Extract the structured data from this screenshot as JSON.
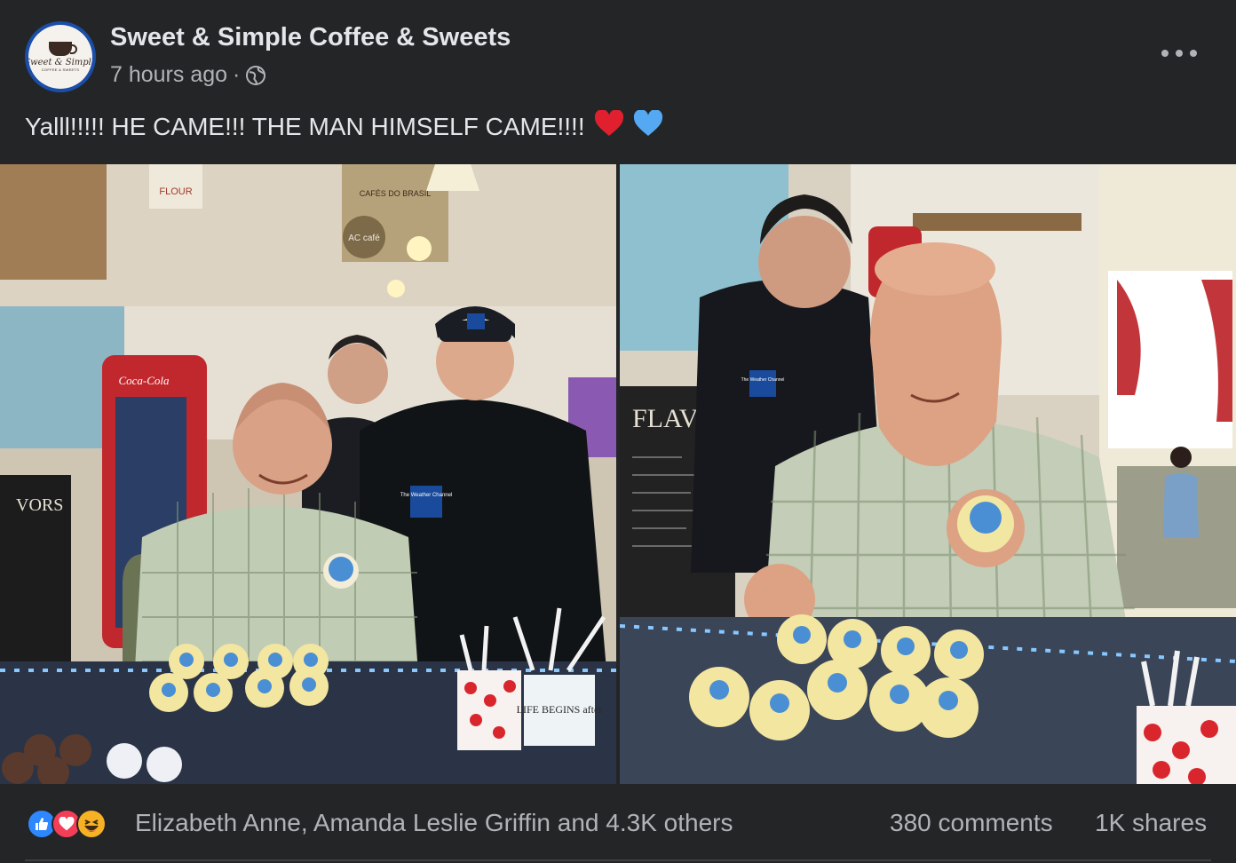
{
  "post": {
    "page_name": "Sweet & Simple Coffee & Sweets",
    "timestamp": "7 hours ago",
    "separator": "·",
    "privacy_icon": "globe-icon",
    "more_icon": "more-options-icon",
    "text": "Yalll!!!!! HE CAME!!! THE MAN HIMSELF CAME!!!!",
    "emojis": [
      "red-heart",
      "blue-heart"
    ],
    "avatar": {
      "logo_script": "Sweet & Simple",
      "logo_sub": "COFFEE & SWEETS"
    }
  },
  "photos": [
    {
      "name": "photo-left",
      "subject": "four people behind cupcake counter"
    },
    {
      "name": "photo-right",
      "subject": "man holding cupcake"
    }
  ],
  "photo_signage": {
    "flour_bag": "FLOUR",
    "coffee_sack": "CAFÉS DO BRASIL",
    "ac_sign": "AC café",
    "coca_cola": "Coca-Cola",
    "hat_logo": "The Weather Channel",
    "jacket_logo": "The Weather Channel",
    "chalkboard_left": "VORS",
    "chalkboard_right": "FLAVOR",
    "mug": "LIFE BEGINS after"
  },
  "footer": {
    "reaction_icons": [
      "like-icon",
      "love-icon",
      "haha-icon"
    ],
    "reaction_names": "Elizabeth Anne, Amanda Leslie Griffin and 4.3K others",
    "comments": "380 comments",
    "shares": "1K shares"
  },
  "colors": {
    "background": "#242526",
    "text_primary": "#e4e6eb",
    "text_secondary": "#b0b3b8",
    "avatar_ring": "#1b4ea8",
    "like_blue": "#2d88ff",
    "love_red": "#f33e58",
    "haha_yellow": "#f7b125"
  }
}
